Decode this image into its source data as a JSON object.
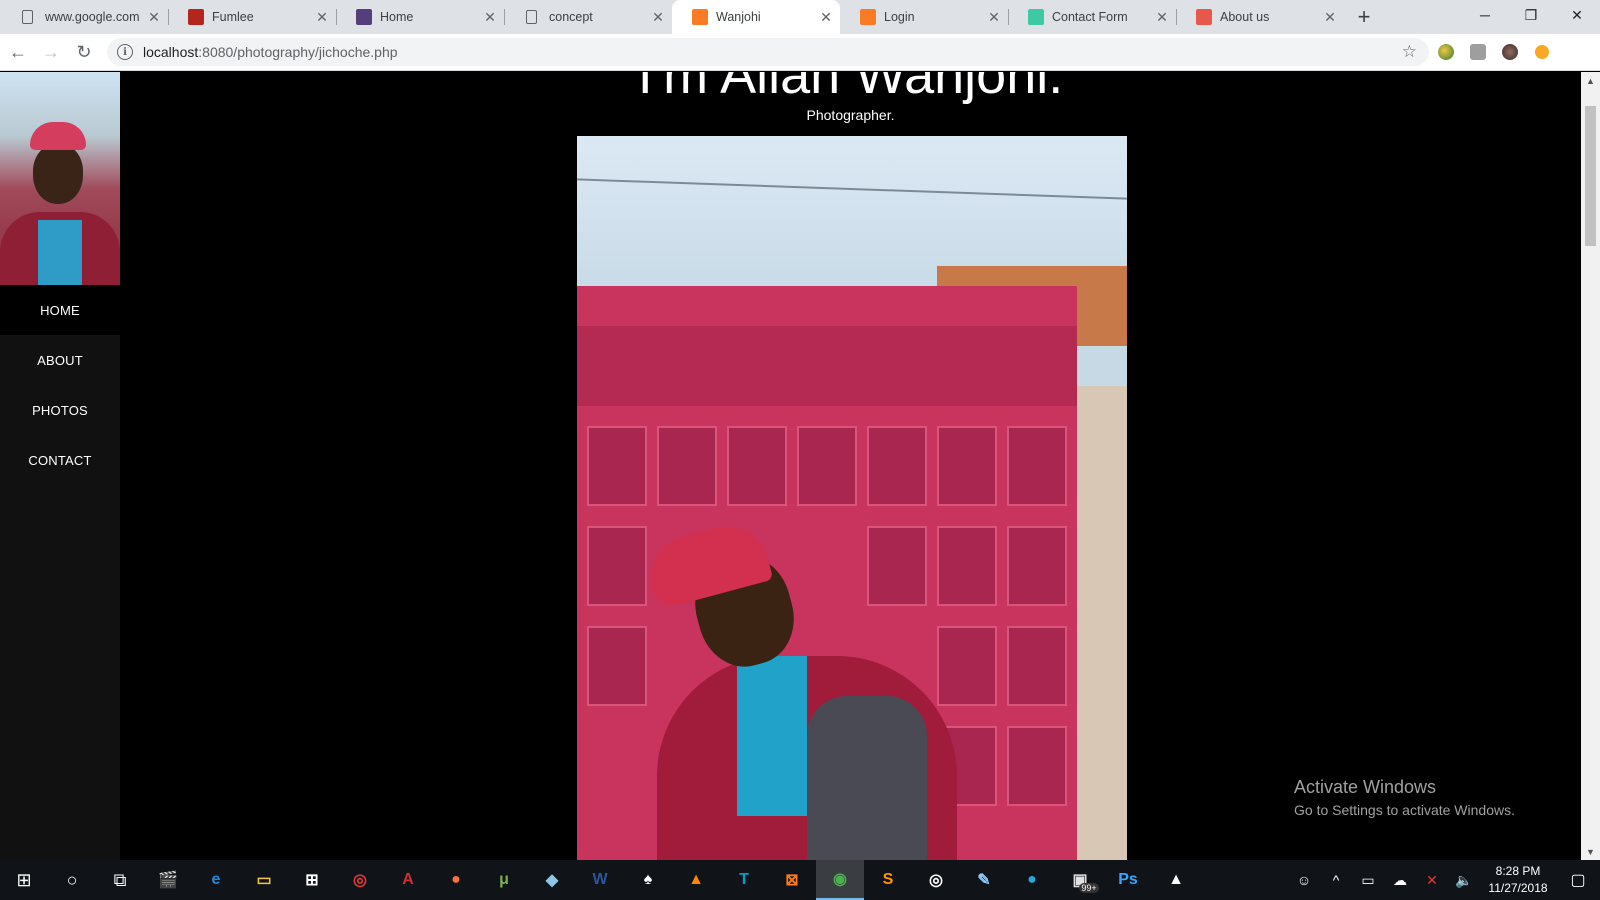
{
  "browser": {
    "tabs": [
      {
        "title": "www.google.com",
        "icon": "page-icon",
        "color": "#5f6368"
      },
      {
        "title": "Fumlee",
        "icon": "s-logo-icon",
        "color": "#b3261e"
      },
      {
        "title": "Home",
        "icon": "bootstrap-icon",
        "color": "#563d7c"
      },
      {
        "title": "concept",
        "icon": "page-icon",
        "color": "#5f6368"
      },
      {
        "title": "Wanjohi",
        "icon": "xampp-icon",
        "color": "#fb7a24"
      },
      {
        "title": "Login",
        "icon": "xampp-icon",
        "color": "#fb7a24"
      },
      {
        "title": "Contact Form",
        "icon": "diamond-icon",
        "color": "#3cc9a4"
      },
      {
        "title": "About us",
        "icon": "flag-icon",
        "color": "#e8584a"
      }
    ],
    "active_tab": 4,
    "new_tab_label": "+",
    "url_host": "localhost",
    "url_path": ":8080/photography/jichoche.php"
  },
  "page": {
    "heading": "I'm Allan Wanjohi.",
    "subtitle": "Photographer.",
    "menu": [
      {
        "label": "HOME",
        "active": true
      },
      {
        "label": "ABOUT",
        "active": false
      },
      {
        "label": "PHOTOS",
        "active": false
      },
      {
        "label": "CONTACT",
        "active": false
      }
    ],
    "watermark_title": "Activate Windows",
    "watermark_sub": "Go to Settings to activate Windows."
  },
  "taskbar": {
    "time": "8:28 PM",
    "date": "11/27/2018",
    "badge": "99+",
    "apps": [
      {
        "name": "movies-icon",
        "color": "#ffffff",
        "glyph": "🎬"
      },
      {
        "name": "edge-icon",
        "color": "#1e88e5",
        "glyph": "e"
      },
      {
        "name": "file-explorer-icon",
        "color": "#f4c542",
        "glyph": "▭"
      },
      {
        "name": "store-icon",
        "color": "#ffffff",
        "glyph": "⊞"
      },
      {
        "name": "app-red-icon",
        "color": "#e53935",
        "glyph": "◎"
      },
      {
        "name": "acrobat-icon",
        "color": "#d32f2f",
        "glyph": "A"
      },
      {
        "name": "firefox-icon",
        "color": "#ff7139",
        "glyph": "●"
      },
      {
        "name": "utorrent-icon",
        "color": "#78b64a",
        "glyph": "μ"
      },
      {
        "name": "notepad-icon",
        "color": "#8ec5e8",
        "glyph": "◆"
      },
      {
        "name": "word-icon",
        "color": "#2b579a",
        "glyph": "W"
      },
      {
        "name": "cards-icon",
        "color": "#ffffff",
        "glyph": "♠"
      },
      {
        "name": "vlc-icon",
        "color": "#ff8800",
        "glyph": "▲"
      },
      {
        "name": "telkom-icon",
        "color": "#00a0c6",
        "glyph": "T"
      },
      {
        "name": "xampp-icon",
        "color": "#fb7a24",
        "glyph": "⊠"
      },
      {
        "name": "chrome-icon",
        "color": "#4caf50",
        "glyph": "◉"
      },
      {
        "name": "sublime-icon",
        "color": "#ff9800",
        "glyph": "S"
      },
      {
        "name": "circle-app-icon",
        "color": "#ffffff",
        "glyph": "◎"
      },
      {
        "name": "paint-icon",
        "color": "#90caf9",
        "glyph": "✎"
      },
      {
        "name": "sphere-icon",
        "color": "#26a8d8",
        "glyph": "●"
      },
      {
        "name": "badge-app-icon",
        "color": "#e0e0e0",
        "glyph": "▣"
      },
      {
        "name": "photoshop-icon",
        "color": "#31a8ff",
        "glyph": "Ps"
      },
      {
        "name": "photos-icon",
        "color": "#ffffff",
        "glyph": "▲"
      }
    ]
  }
}
